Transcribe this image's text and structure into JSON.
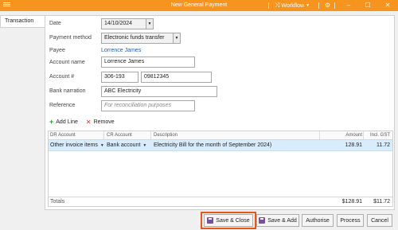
{
  "window": {
    "title": "New General Payment",
    "workflow_label": "Workflow",
    "accent_color": "#f7941d"
  },
  "tabs": [
    {
      "label": "Transaction",
      "active": true
    }
  ],
  "form": {
    "date": {
      "label": "Date",
      "value": "14/10/2024"
    },
    "payment_method": {
      "label": "Payment method",
      "value": "Electronic funds transfer"
    },
    "payee": {
      "label": "Payee",
      "value": "Lorrence James"
    },
    "account_name": {
      "label": "Account name",
      "value": "Lorrence James"
    },
    "account_number": {
      "label": "Account #",
      "bsb": "306-193",
      "number": "09812345"
    },
    "bank_narration": {
      "label": "Bank narration",
      "value": "ABC Electricity"
    },
    "reference": {
      "label": "Reference",
      "placeholder": "For reconciliation purposes"
    }
  },
  "grid_toolbar": {
    "add_line": "Add Line",
    "remove": "Remove"
  },
  "grid": {
    "columns": [
      "DR Account",
      "CR Account",
      "Description",
      "Amount",
      "Incl. GST"
    ],
    "rows": [
      {
        "dr_account": "Other invoice items",
        "cr_account": "Bank account",
        "description": "Electricity Bill for the month of September 2024)",
        "amount": "128.91",
        "incl_gst": "11.72"
      }
    ],
    "totals": {
      "label": "Totals",
      "amount": "$128.91",
      "incl_gst": "$11.72"
    }
  },
  "buttons": {
    "save_close": "Save & Close",
    "save_add": "Save & Add",
    "authorise": "Authorise",
    "process": "Process",
    "cancel": "Cancel"
  }
}
